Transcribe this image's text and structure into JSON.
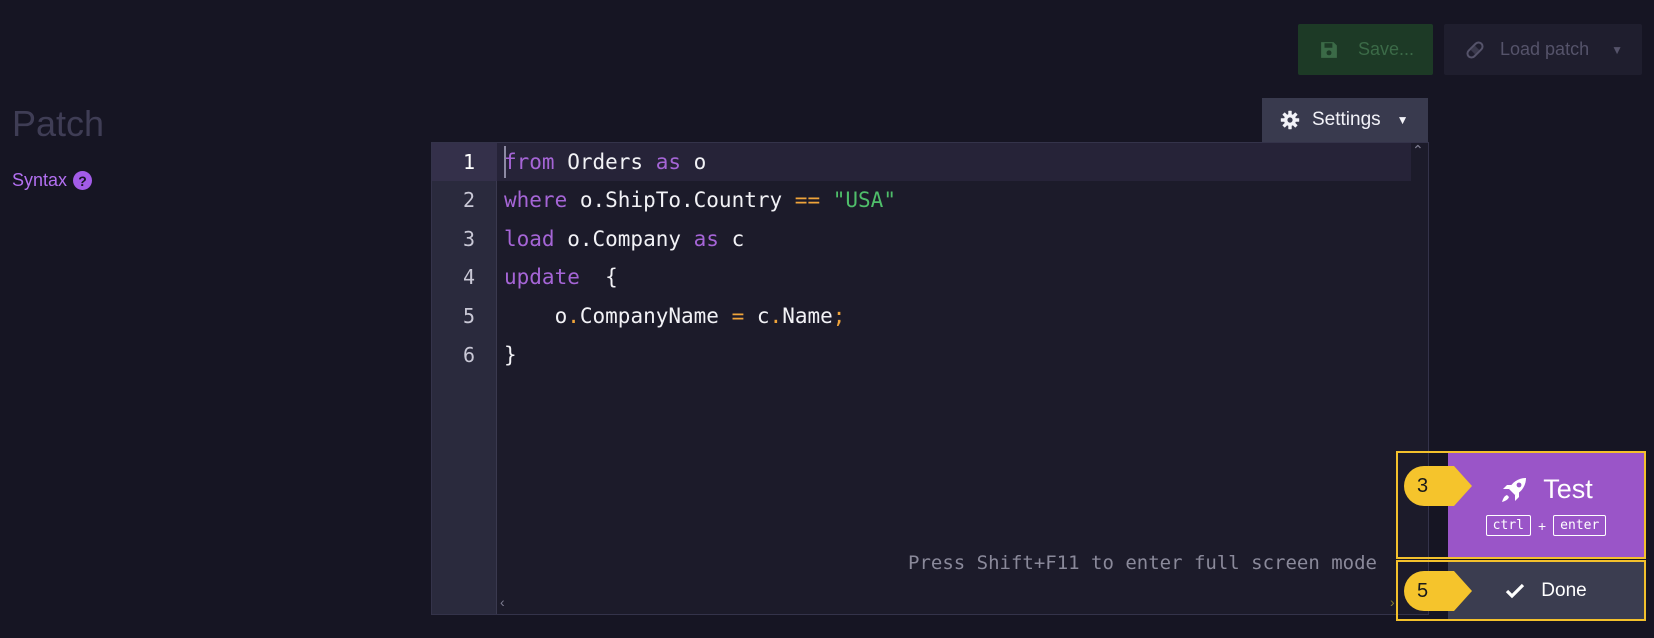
{
  "toolbar": {
    "save_label": "Save...",
    "load_label": "Load patch"
  },
  "page": {
    "title": "Patch",
    "syntax_label": "Syntax",
    "help_glyph": "?"
  },
  "settings": {
    "label": "Settings"
  },
  "editor": {
    "line_numbers": [
      "1",
      "2",
      "3",
      "4",
      "5",
      "6"
    ],
    "lines": [
      [
        {
          "t": "from",
          "c": "kw"
        },
        {
          "t": " Orders ",
          "c": "plain"
        },
        {
          "t": "as",
          "c": "kw"
        },
        {
          "t": " o",
          "c": "plain"
        }
      ],
      [
        {
          "t": "where",
          "c": "kw"
        },
        {
          "t": " o.ShipTo.Country ",
          "c": "plain"
        },
        {
          "t": "==",
          "c": "op"
        },
        {
          "t": " ",
          "c": "plain"
        },
        {
          "t": "\"USA\"",
          "c": "str"
        }
      ],
      [
        {
          "t": "load",
          "c": "kw"
        },
        {
          "t": " o.Company ",
          "c": "plain"
        },
        {
          "t": "as",
          "c": "kw"
        },
        {
          "t": " c",
          "c": "plain"
        }
      ],
      [
        {
          "t": "update",
          "c": "kw"
        },
        {
          "t": "  {",
          "c": "plain"
        }
      ],
      [
        {
          "t": "    o",
          "c": "plain"
        },
        {
          "t": ".",
          "c": "op"
        },
        {
          "t": "CompanyName ",
          "c": "plain"
        },
        {
          "t": "=",
          "c": "op"
        },
        {
          "t": " c",
          "c": "plain"
        },
        {
          "t": ".",
          "c": "op"
        },
        {
          "t": "Name",
          "c": "plain"
        },
        {
          "t": ";",
          "c": "op"
        }
      ],
      [
        {
          "t": "}",
          "c": "plain"
        }
      ]
    ],
    "fullscreen_hint": "Press Shift+F11 to enter full screen mode"
  },
  "actions": {
    "test_label": "Test",
    "shortcut_key1": "ctrl",
    "shortcut_plus": "+",
    "shortcut_key2": "enter",
    "done_label": "Done"
  },
  "markers": {
    "test": "3",
    "done": "5"
  },
  "colors": {
    "background": "#161523",
    "accent_purple": "#9a55c8",
    "link_purple": "#b26ff0",
    "highlight_yellow": "#f5c42c",
    "save_green": "#1d3a26"
  },
  "icons": {
    "save": "floppy-disk-icon",
    "load": "bandage-icon",
    "settings": "gear-icon",
    "help": "question-circle-icon",
    "test": "rocket-icon",
    "done": "checkmark-icon"
  }
}
